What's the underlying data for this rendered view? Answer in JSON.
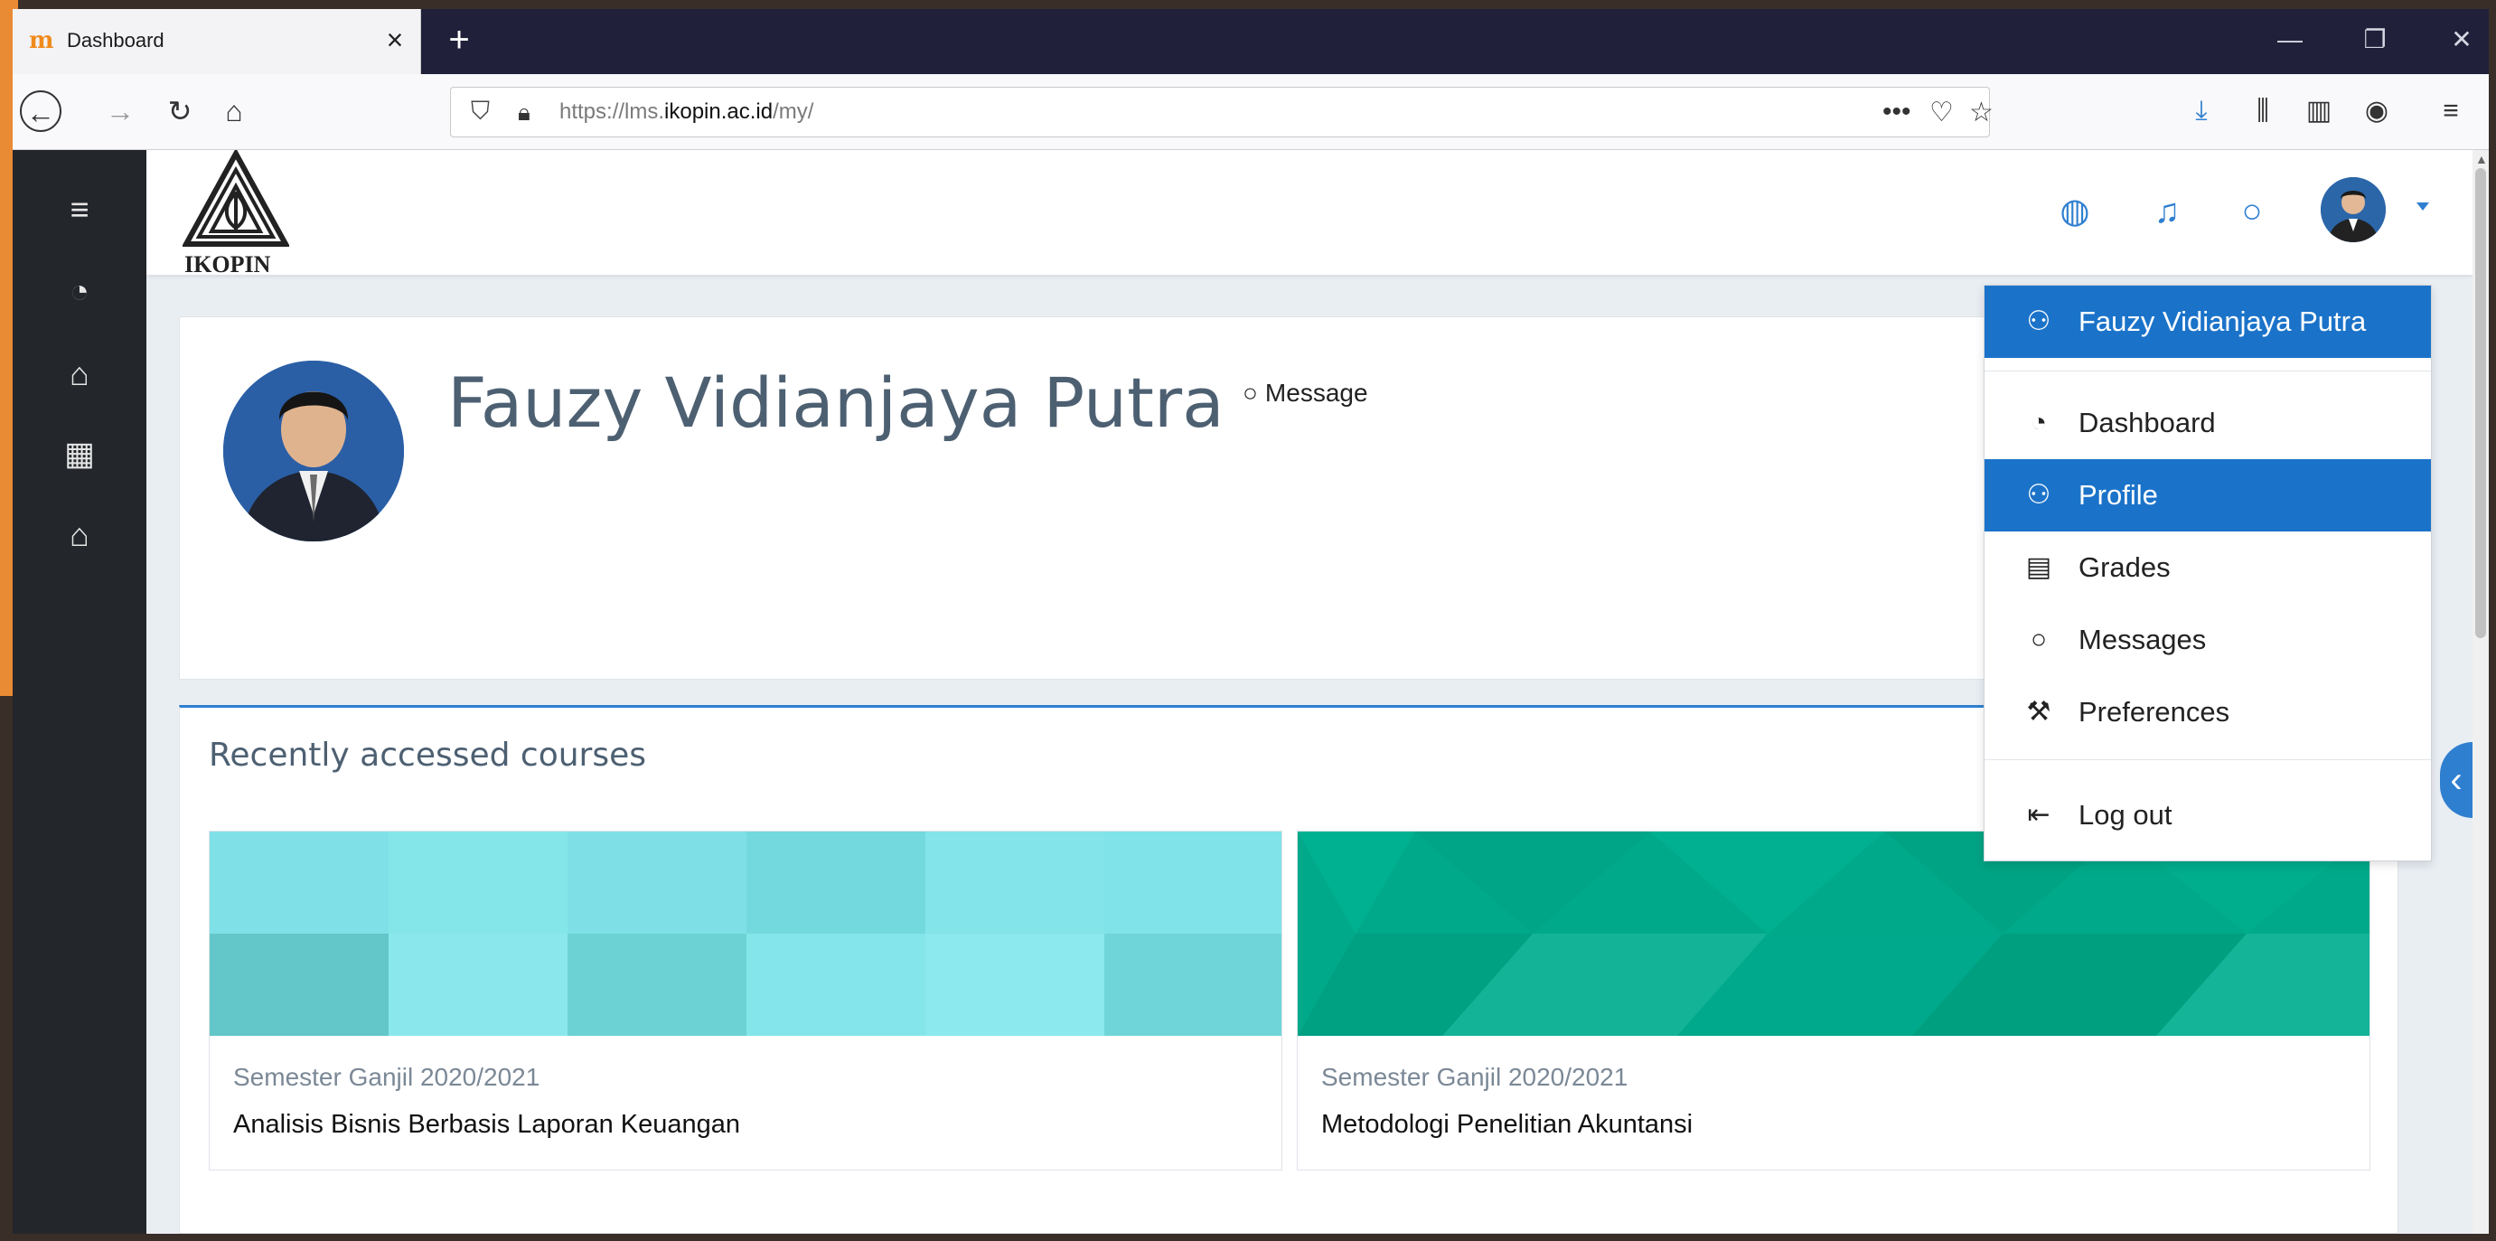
{
  "browser": {
    "tab_title": "Dashboard",
    "tab_close": "×",
    "new_tab": "+",
    "url_prefix": "https://lms.",
    "url_domain": "ikopin.ac.id",
    "url_path": "/my/",
    "window_minimize": "—",
    "window_restore": "❐",
    "window_close": "✕"
  },
  "header": {
    "logo_text": "IKOPIN"
  },
  "profile": {
    "name": "Fauzy Vidianjaya Putra",
    "message_link": "Message"
  },
  "recent": {
    "title": "Recently accessed courses",
    "courses": [
      {
        "category": "Semester Ganjil 2020/2021",
        "name": "Analisis Bisnis Berbasis Laporan Keuangan"
      },
      {
        "category": "Semester Ganjil 2020/2021",
        "name": "Metodologi Penelitian Akuntansi"
      }
    ]
  },
  "user_menu": {
    "header_name": "Fauzy Vidianjaya Putra",
    "items": [
      {
        "label": "Dashboard",
        "icon": "dashboard-icon"
      },
      {
        "label": "Profile",
        "icon": "user-icon"
      },
      {
        "label": "Grades",
        "icon": "grades-icon"
      },
      {
        "label": "Messages",
        "icon": "message-icon"
      },
      {
        "label": "Preferences",
        "icon": "wrench-icon"
      },
      {
        "label": "Log out",
        "icon": "logout-icon"
      }
    ],
    "active_item": "Profile"
  },
  "colors": {
    "accent": "#1b73c9",
    "drawer": "#23262b",
    "course1": "#7fe3e8",
    "course2": "#00a88a"
  }
}
